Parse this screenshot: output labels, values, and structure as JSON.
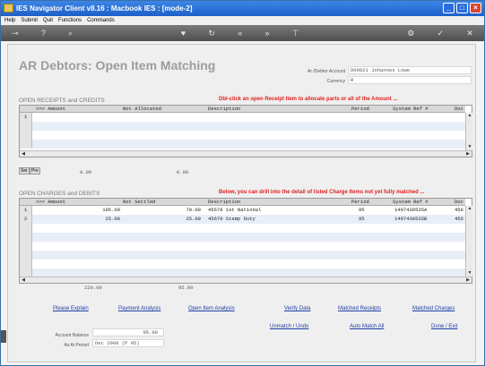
{
  "window": {
    "title": "IES Navigator Client v8.16 : Macbook IES :      [mode-2]"
  },
  "menu": [
    "Help",
    "Submit",
    "Quit",
    "Functions",
    "Commands"
  ],
  "toolbar": {
    "icons": [
      "key-icon",
      "help-icon",
      "search-icon",
      "heart-icon",
      "refresh-icon",
      "rewind-icon",
      "fast-forward-icon",
      "pin-icon",
      "gear-icon",
      "check-icon",
      "close-icon"
    ]
  },
  "page": {
    "heading": "AR Debtors: Open Item Matching",
    "account_label": "Ar /Debtor Account",
    "account_value": "D00021 Johannes Lowe",
    "currency_label": "Currency",
    "currency_value": "R"
  },
  "receipts": {
    "title": "OPEN RECEIPTS and CREDITS",
    "instruction": "Dbl-click an open Receipt Item to allocate   parts or all of the Amount ...",
    "columns": [
      ">>> Amount",
      "Not Allocated",
      "Description",
      "Period",
      "System Ref #",
      "Doc"
    ],
    "rows": [
      {
        "num": "1",
        "amount": "",
        "not_allocated": "",
        "description": "",
        "period": "",
        "ref": "",
        "doc": ""
      }
    ],
    "tab1": "Ser",
    "tab2": "Pre",
    "total_amount": "0.00",
    "total_not_allocated": "0.00"
  },
  "charges": {
    "title": "OPEN CHARGES and DEBITS",
    "instruction": "Below, you can drill into the detail  of listed Charge Items not  yet fully matched ...",
    "columns": [
      ">>> Amount",
      "Not Settled",
      "Description",
      "Period",
      "System Ref #",
      "Doc"
    ],
    "rows": [
      {
        "num": "1",
        "amount": "195.00",
        "not_settled": "70.00",
        "description": "45678 1st National",
        "period": "95",
        "ref": "1497439535A",
        "doc": "456"
      },
      {
        "num": "2",
        "amount": "25.00",
        "not_settled": "25.00",
        "description": "45670 Stamp Duty",
        "period": "95",
        "ref": "1497439535B",
        "doc": "456"
      }
    ],
    "total_amount": "220.00",
    "total_not_settled": "95.00"
  },
  "links": {
    "please_explain": "Please Explain",
    "payment_analysis": "Payment Analysis",
    "open_item_analysis": "Open Item Analysis",
    "verify_data": "Verify Data",
    "matched_receipts": "Matched Receipts",
    "matched_charges": "Matched Charges",
    "unmatch_undo": "Unmatch / Undo",
    "auto_match_all": "Auto Match All",
    "done_exit": "Done / Exit"
  },
  "balance": {
    "label": "Account Balance",
    "value": "95.00",
    "period_label": "As At Period",
    "period_value": "Dec 2008 (P 95)"
  }
}
